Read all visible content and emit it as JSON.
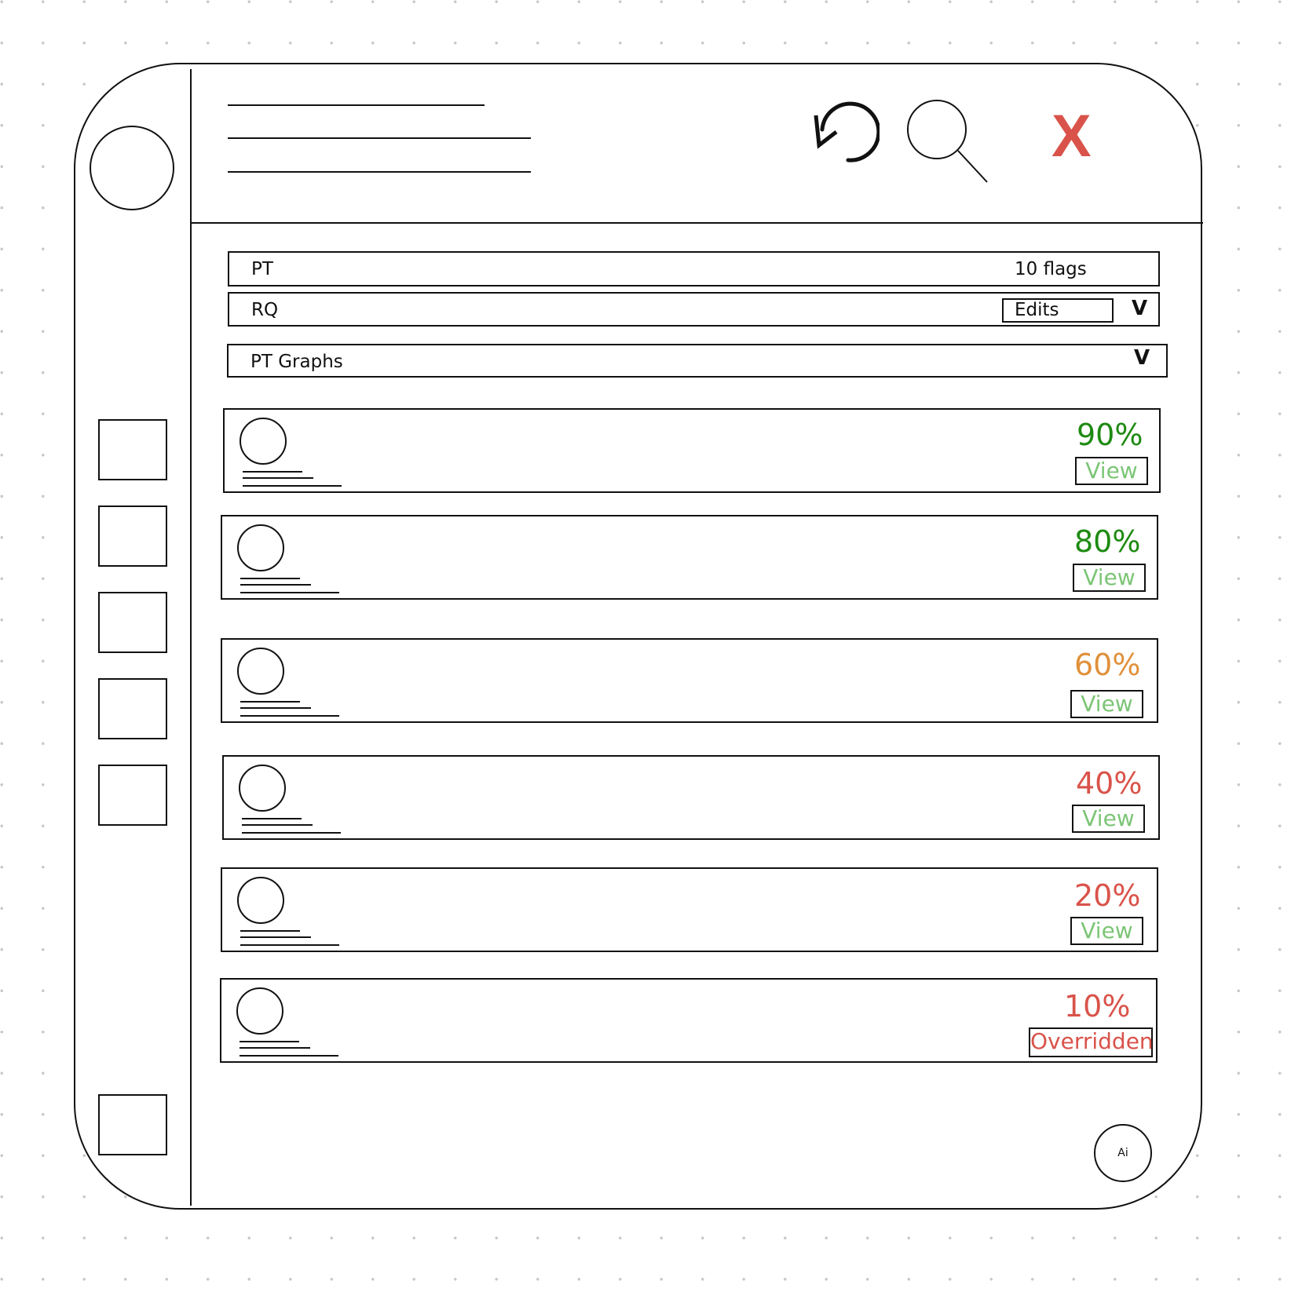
{
  "colors": {
    "close": "#d9534a",
    "pct_green": "#1e8a12",
    "pct_orange": "#e0913b",
    "pct_red": "#d9534a",
    "view_text": "#7cc576",
    "overridden": "#d9534a"
  },
  "header": {
    "icons": [
      "undo-icon",
      "search-icon",
      "close-icon"
    ],
    "close_label": "X"
  },
  "sidebar": {
    "avatar_icon": "avatar-icon",
    "nav_count": 5
  },
  "bars": {
    "pt": {
      "label": "PT",
      "flags": "10 flags"
    },
    "rq": {
      "label": "RQ",
      "edits": "Edits",
      "chevron": "V"
    },
    "graphs": {
      "label": "PT Graphs",
      "chevron": "V"
    }
  },
  "cards": [
    {
      "pct": "90%",
      "pct_color": "#1e8a12",
      "action": "View"
    },
    {
      "pct": "80%",
      "pct_color": "#1e8a12",
      "action": "View"
    },
    {
      "pct": "60%",
      "pct_color": "#e0913b",
      "action": "View"
    },
    {
      "pct": "40%",
      "pct_color": "#d9534a",
      "action": "View"
    },
    {
      "pct": "20%",
      "pct_color": "#d9534a",
      "action": "View"
    },
    {
      "pct": "10%",
      "pct_color": "#d9534a",
      "action": "Overridden"
    }
  ],
  "ai_button": {
    "label": "Ai"
  }
}
